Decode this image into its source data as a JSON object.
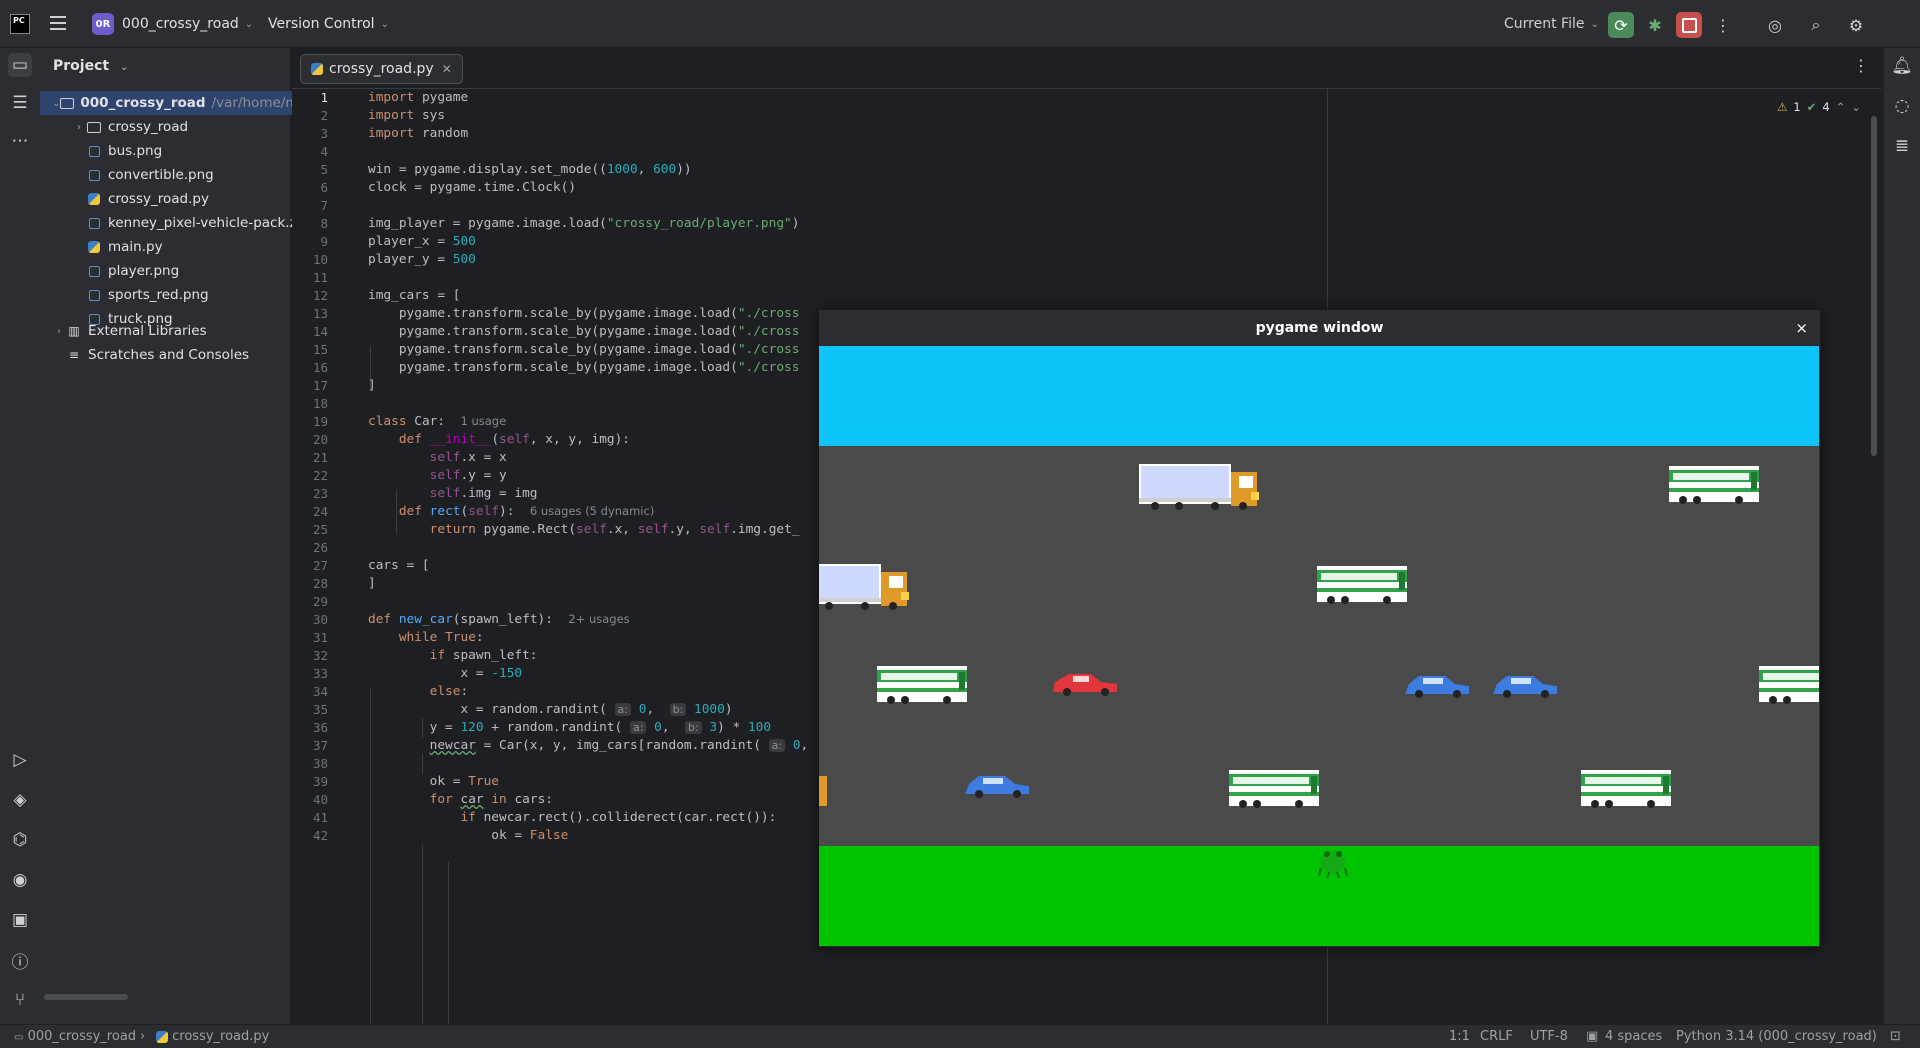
{
  "toolbar": {
    "logo": "PC",
    "project_badge": "0R",
    "project_name": "000_crossy_road",
    "vcs": "Version Control",
    "run_config": "Current File"
  },
  "project_panel": {
    "header": "Project",
    "root_name": "000_crossy_road",
    "root_path": "/var/home/ma",
    "items": [
      {
        "label": "crossy_road",
        "kind": "dir"
      },
      {
        "label": "bus.png",
        "kind": "img"
      },
      {
        "label": "convertible.png",
        "kind": "img"
      },
      {
        "label": "crossy_road.py",
        "kind": "py"
      },
      {
        "label": "kenney_pixel-vehicle-pack.z",
        "kind": "img"
      },
      {
        "label": "main.py",
        "kind": "py"
      },
      {
        "label": "player.png",
        "kind": "img"
      },
      {
        "label": "sports_red.png",
        "kind": "img"
      },
      {
        "label": "truck.png",
        "kind": "img"
      }
    ],
    "external_libraries": "External Libraries",
    "scratches": "Scratches and Consoles"
  },
  "editor": {
    "tab_label": "crossy_road.py",
    "inspection": {
      "warnings": "1",
      "checks": "4"
    },
    "line_numbers": [
      "1",
      "2",
      "3",
      "4",
      "5",
      "6",
      "7",
      "8",
      "9",
      "10",
      "11",
      "12",
      "13",
      "14",
      "15",
      "16",
      "17",
      "18",
      "19",
      "20",
      "21",
      "22",
      "23",
      "24",
      "25",
      "26",
      "27",
      "28",
      "29",
      "30",
      "31",
      "32",
      "33",
      "34",
      "35",
      "36",
      "37",
      "38",
      "39",
      "40",
      "41",
      "42"
    ],
    "hints": {
      "class_car": "1 usage",
      "rect": "6 usages (5 dynamic)",
      "new_car": "2+ usages",
      "ph_a": "a:",
      "ph_b": "b:"
    }
  },
  "pygame": {
    "title": "pygame window",
    "close": "×"
  },
  "statusbar": {
    "breadcrumb_project": "000_crossy_road",
    "breadcrumb_file": "crossy_road.py",
    "position": "1:1",
    "line_sep": "CRLF",
    "encoding": "UTF-8",
    "indent": "4 spaces",
    "interpreter": "Python 3.14 (000_crossy_road)"
  },
  "colors": {
    "sky": "#0dc4f8",
    "road": "#4a4a4a",
    "grass": "#00c400",
    "run_button": "#4c8a5a",
    "stop_button": "#c94f4f"
  }
}
